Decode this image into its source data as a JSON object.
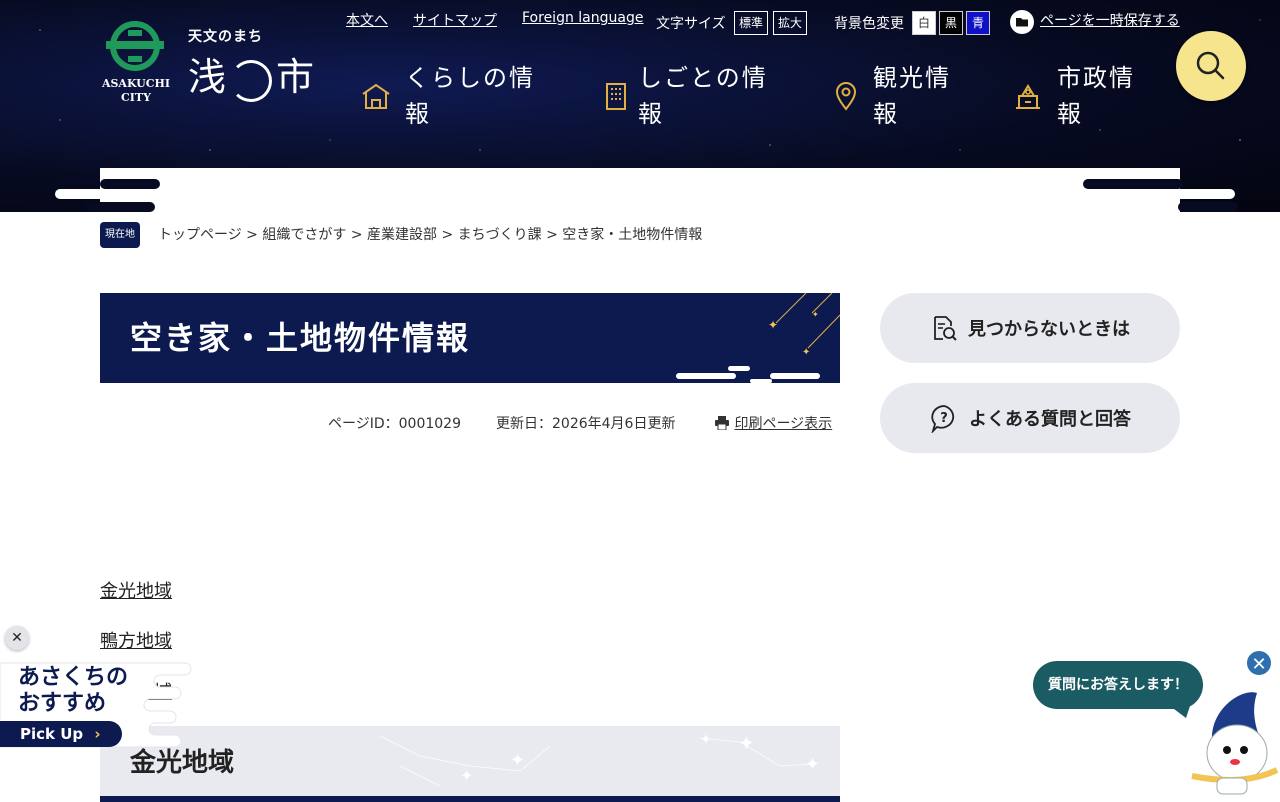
{
  "logo": {
    "tagline": "天文のまち",
    "name_left": "浅",
    "name_right": "市",
    "city_en_1": "ASAKUCHI",
    "city_en_2": "CITY"
  },
  "utility": {
    "honbun": "本文へ",
    "sitemap": "サイトマップ",
    "foreign": "Foreign language",
    "text_size_label": "文字サイズ",
    "size_standard": "標準",
    "size_large": "拡大",
    "bg_label": "背景色変更",
    "bg_white": "白",
    "bg_black": "黒",
    "bg_blue": "青",
    "save_page": "ページを一時保存する"
  },
  "gnav": [
    {
      "line1": "くらしの情",
      "line2": "報"
    },
    {
      "line1": "しごとの情",
      "line2": "報"
    },
    {
      "line1": "観光情",
      "line2": "報"
    },
    {
      "line1": "市政情",
      "line2": "報"
    }
  ],
  "breadcrumb": {
    "badge": "現在地",
    "items": [
      "トップページ",
      "組織でさがす",
      "産業建設部",
      "まちづくり課",
      "空き家・土地物件情報"
    ],
    "sep": " > "
  },
  "page": {
    "title": "空き家・土地物件情報",
    "page_id": "ページID：0001029",
    "updated": "更新日：2026年4月6日更新",
    "print": "印刷ページ表示"
  },
  "side": {
    "not_found": "見つからないときは",
    "faq": "よくある質問と回答"
  },
  "areas": [
    "金光地域",
    "鴨方地域",
    "寄島地域"
  ],
  "section_title": "金光地域",
  "pickup": {
    "line1": "あさくちの",
    "line2": "おすすめ",
    "button": "Pick Up"
  },
  "chat": {
    "bubble": "質問にお答えします！"
  },
  "colors": {
    "navy": "#0d1a50",
    "search_yellow": "#f6e58d",
    "chat_teal": "#1b5b63"
  }
}
